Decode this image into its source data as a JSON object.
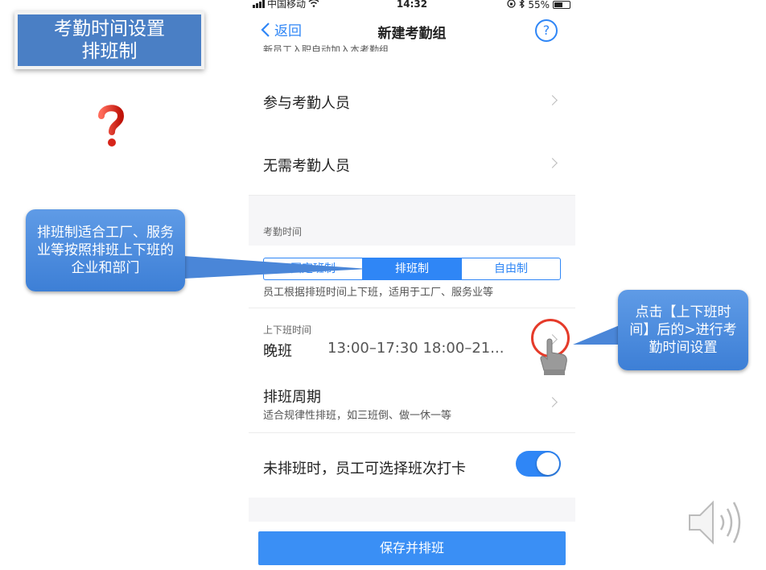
{
  "title_card": {
    "line1": "考勤时间设置",
    "line2": "排班制"
  },
  "status_bar": {
    "carrier": "中国移动",
    "time": "14:32",
    "battery": "55%"
  },
  "navbar": {
    "back_label": "返回",
    "title": "新建考勤组",
    "help_symbol": "?"
  },
  "cut_off_text": "新员工入职自动加入本考勤组",
  "rows": {
    "participants": "参与考勤人员",
    "non_participants": "无需考勤人员"
  },
  "attendance_time": {
    "section_title": "考勤时间",
    "segments": [
      "固定班制",
      "排班制",
      "自由制"
    ],
    "selected_segment": "排班制",
    "description": "员工根据排班时间上下班，适用于工厂、服务业等"
  },
  "shift_row": {
    "small_label": "上下班时间",
    "shift_name": "晚班",
    "times": "13:00–17:30  18:00–21..."
  },
  "cycle_row": {
    "title": "排班周期",
    "subtitle": "适合规律性排班，如三班倒、做一休一等"
  },
  "toggle_row": {
    "label": "未排班时，员工可选择班次打卡",
    "enabled": true
  },
  "save_button": "保存并排班",
  "callouts": {
    "left": "排班制适合工厂、服务业等按照排班上下班的企业和部门",
    "right": "点击【上下班时间】后的>进行考勤时间设置"
  },
  "colors": {
    "accent": "#2f86f6",
    "callout": "#4a86d8",
    "title_card": "#4a7fc5",
    "circle": "#e53b2a"
  }
}
